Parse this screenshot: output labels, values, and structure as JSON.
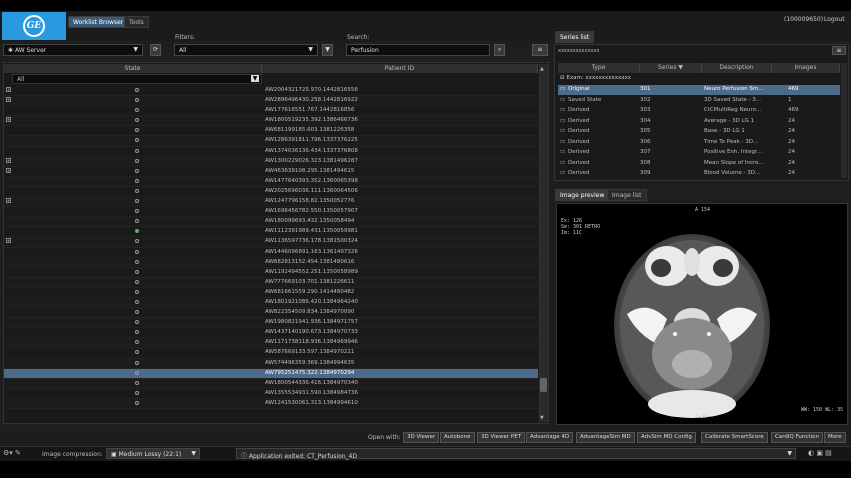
{
  "header": {
    "tabs": [
      "Worklist Browser",
      "Tools"
    ],
    "user": "(100009650)",
    "logout": "Logout",
    "logo_text": "GE"
  },
  "toolbar": {
    "server": "AW Server",
    "filters_label": "Filters:",
    "filter_value": "All",
    "search_label": "Search:",
    "search_value": "Perfusion"
  },
  "worklist": {
    "columns": [
      "State",
      "Patient ID"
    ],
    "state_filter": "All",
    "rows": [
      {
        "id": "AW2004321725.970.1442816558",
        "exp": true,
        "state": "grey"
      },
      {
        "id": "AW2896496430.258.1442816922",
        "exp": true,
        "state": "grey"
      },
      {
        "id": "AW177616551.767.1442816856",
        "exp": false,
        "state": "grey"
      },
      {
        "id": "AW1800519235.392.1386466736",
        "exp": true,
        "state": "grey"
      },
      {
        "id": "AW681199185.603.1381226358",
        "exp": false,
        "state": "grey"
      },
      {
        "id": "AW1286391811.796.1337376225",
        "exp": false,
        "state": "grey"
      },
      {
        "id": "AW1374036136.434.1337376808",
        "exp": false,
        "state": "grey"
      },
      {
        "id": "AW1300229026.323.1381496287",
        "exp": true,
        "state": "grey"
      },
      {
        "id": "AW463639108.295.1381494615",
        "exp": true,
        "state": "grey"
      },
      {
        "id": "AW1477640393.352.1360065398",
        "exp": false,
        "state": "grey"
      },
      {
        "id": "AW2025696036.111.1360064506",
        "exp": false,
        "state": "grey"
      },
      {
        "id": "AW1247796158.82.1350052776",
        "exp": true,
        "state": "grey"
      },
      {
        "id": "AW1696456782.550.1350057907",
        "exp": false,
        "state": "grey"
      },
      {
        "id": "AW180099693.432.1350058494",
        "exp": false,
        "state": "grey"
      },
      {
        "id": "AW1112391989.431.1350059981",
        "exp": false,
        "state": "green"
      },
      {
        "id": "AW1136597736.178.1381500324",
        "exp": true,
        "state": "grey"
      },
      {
        "id": "AW1446096891.163.1361497326",
        "exp": false,
        "state": "grey"
      },
      {
        "id": "AW682813152.454.1381480616",
        "exp": false,
        "state": "grey"
      },
      {
        "id": "AW1192494552.251.1350058989",
        "exp": false,
        "state": "grey"
      },
      {
        "id": "AW777669103.701.1381226611",
        "exp": false,
        "state": "grey"
      },
      {
        "id": "AW681661559.290.1414480482",
        "exp": false,
        "state": "grey"
      },
      {
        "id": "AW1801921086.420.1384964240",
        "exp": false,
        "state": "grey"
      },
      {
        "id": "AW822354509.834.1384970090",
        "exp": false,
        "state": "grey"
      },
      {
        "id": "AW1980821941.936.1384971757",
        "exp": false,
        "state": "grey"
      },
      {
        "id": "AW1437140190.673.1384970733",
        "exp": false,
        "state": "grey"
      },
      {
        "id": "AW1171738118.936.1384969946",
        "exp": false,
        "state": "grey"
      },
      {
        "id": "AW587669133.597.1384970221",
        "exp": false,
        "state": "grey"
      },
      {
        "id": "AW574496359.369.1384994635",
        "exp": false,
        "state": "grey"
      },
      {
        "id": "AW795251475.322.1384970294",
        "exp": false,
        "state": "grey"
      },
      {
        "id": "AW1800544336.416.1384970340",
        "exp": false,
        "state": "grey"
      },
      {
        "id": "AW1355534931.590.1384984736",
        "exp": false,
        "state": "grey"
      },
      {
        "id": "AW1241530061.313.1384994610",
        "exp": false,
        "state": "grey"
      }
    ],
    "selected_index": 28
  },
  "series": {
    "tab": "Series list",
    "header_text": "xxxxxxxxxxxxxx",
    "columns": [
      "Type",
      "Series ▼",
      "Description",
      "Images"
    ],
    "exam_label": "Exam: xxxxxxxxxxxxxx",
    "rows": [
      {
        "type": "Original",
        "series": "301",
        "desc": "Neuro Perfusion Sm...",
        "images": "469"
      },
      {
        "type": "Saved State",
        "series": "302",
        "desc": "3D Saved State - 3...",
        "images": "1"
      },
      {
        "type": "Derived",
        "series": "303",
        "desc": "CtCMultiReg Neuro...",
        "images": "469"
      },
      {
        "type": "Derived",
        "series": "304",
        "desc": "Average - 3D LG 1",
        "images": "24"
      },
      {
        "type": "Derived",
        "series": "305",
        "desc": "Base - 3D LG 1",
        "images": "24"
      },
      {
        "type": "Derived",
        "series": "306",
        "desc": "Time To Peak - 3D...",
        "images": "24"
      },
      {
        "type": "Derived",
        "series": "307",
        "desc": "Positive Enh. Integr...",
        "images": "24"
      },
      {
        "type": "Derived",
        "series": "308",
        "desc": "Mean Slope of Incre...",
        "images": "24"
      },
      {
        "type": "Derived",
        "series": "309",
        "desc": "Blood Volume - 3D...",
        "images": "24"
      }
    ]
  },
  "preview": {
    "tabs": [
      "Image preview",
      "Image list"
    ],
    "top_label": "A 154",
    "bottom_label": "P 99",
    "overlay_tl": [
      "Ex: 126",
      "Se: 301 RETRO",
      "Im: 11C"
    ],
    "overlay_br": "WW: 150 WL: 35"
  },
  "bottom": {
    "open_with": "Open with:",
    "buttons": [
      "3D Viewer",
      "Autobone",
      "3D Viewer PET",
      "Advantage 4D",
      "AdvantageSim MD",
      "AdvSim MD Config",
      "Calibrate SmartScore",
      "CardIQ Function",
      "More"
    ]
  },
  "status": {
    "compression_label": "Image compression:",
    "compression_value": "Medium Lossy (22:1)",
    "message": "Application exited: CT_Perfusion_4D"
  }
}
